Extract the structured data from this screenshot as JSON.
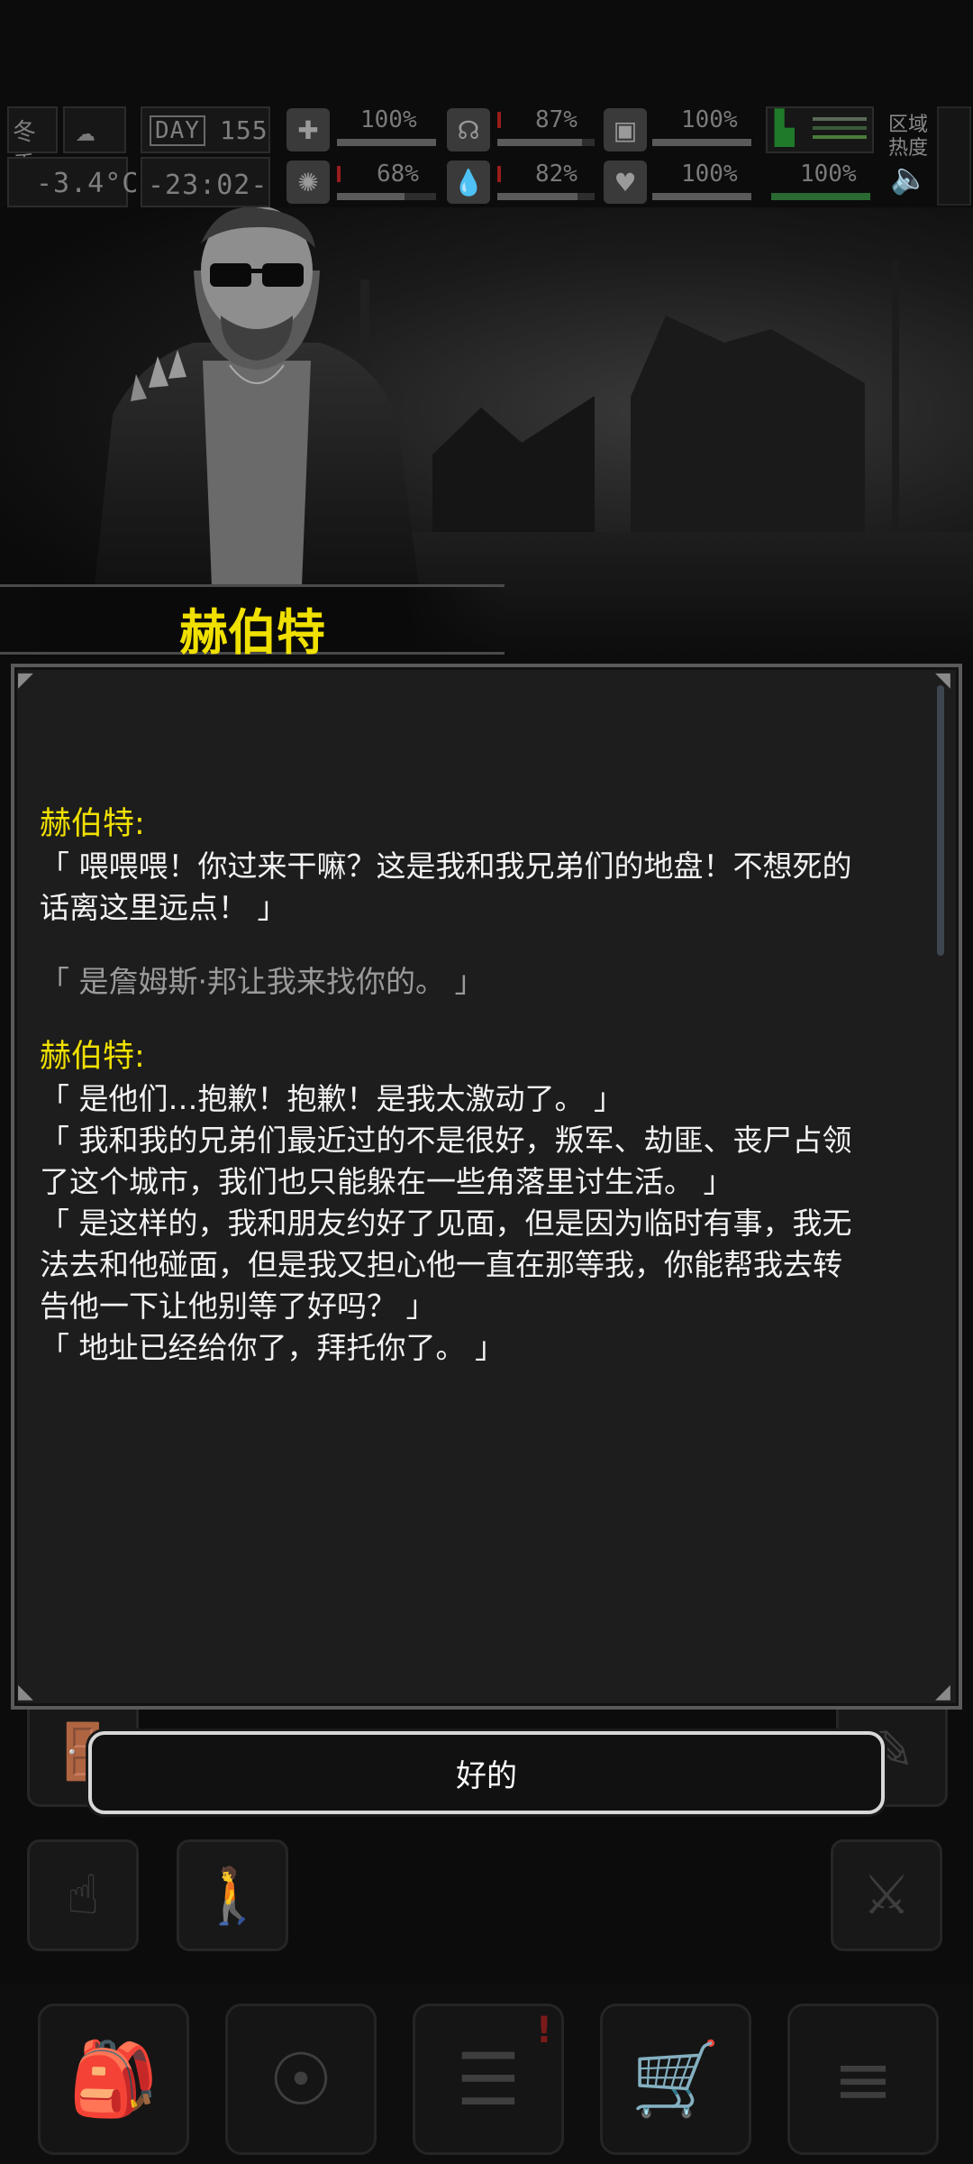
{
  "hud": {
    "season": "冬季",
    "day_label": "DAY",
    "day_number": "155",
    "temperature": "-3.4°C",
    "time": "-23:02-",
    "region_heat_label_1": "区域",
    "region_heat_label_2": "热度",
    "stats": {
      "health": "100%",
      "hunger": "87%",
      "armor": "100%",
      "mood": "68%",
      "thirst": "82%",
      "vitality": "100%",
      "stamina": "100%"
    },
    "stat_levels": {
      "health": 1.0,
      "hunger": 0.87,
      "armor": 1.0,
      "mood": 0.68,
      "thirst": 0.82,
      "vitality": 1.0,
      "stamina": 1.0
    }
  },
  "npc": {
    "name": "赫伯特"
  },
  "dialog": {
    "speaker_1": "赫伯特:",
    "line_1a": "「 喂喂喂！你过来干嘛？这是我和我兄弟们的地盘！不想死的",
    "line_1b": "话离这里远点！ 」",
    "player_reply": "「 是詹姆斯·邦让我来找你的。 」",
    "speaker_2": "赫伯特:",
    "line_2": "「 是他们…抱歉！抱歉！是我太激动了。 」",
    "line_3a": "「 我和我的兄弟们最近过的不是很好，叛军、劫匪、丧尸占领",
    "line_3b": "了这个城市，我们也只能躲在一些角落里讨生活。 」",
    "line_4a": "「 是这样的，我和朋友约好了见面，但是因为临时有事，我无",
    "line_4b": "法去和他碰面，但是我又担心他一直在那等我，你能帮我去转",
    "line_4c": "告他一下让他别等了好吗？ 」",
    "line_5": "「 地址已经给你了，拜托你了。 」"
  },
  "confirm_button": "好的",
  "icons": {
    "actions": [
      "tap-gesture-icon",
      "walk-icon",
      "exit-door-icon",
      "fight-icon",
      "note-icon"
    ],
    "menu": [
      "backpack-icon",
      "brain-icon",
      "journal-icon",
      "cart-icon",
      "menu-list-icon"
    ]
  },
  "colors": {
    "accent": "#f0e000",
    "text": "#f2f2f2",
    "muted": "#9a9a9a",
    "panel": "#1d1d1d"
  }
}
